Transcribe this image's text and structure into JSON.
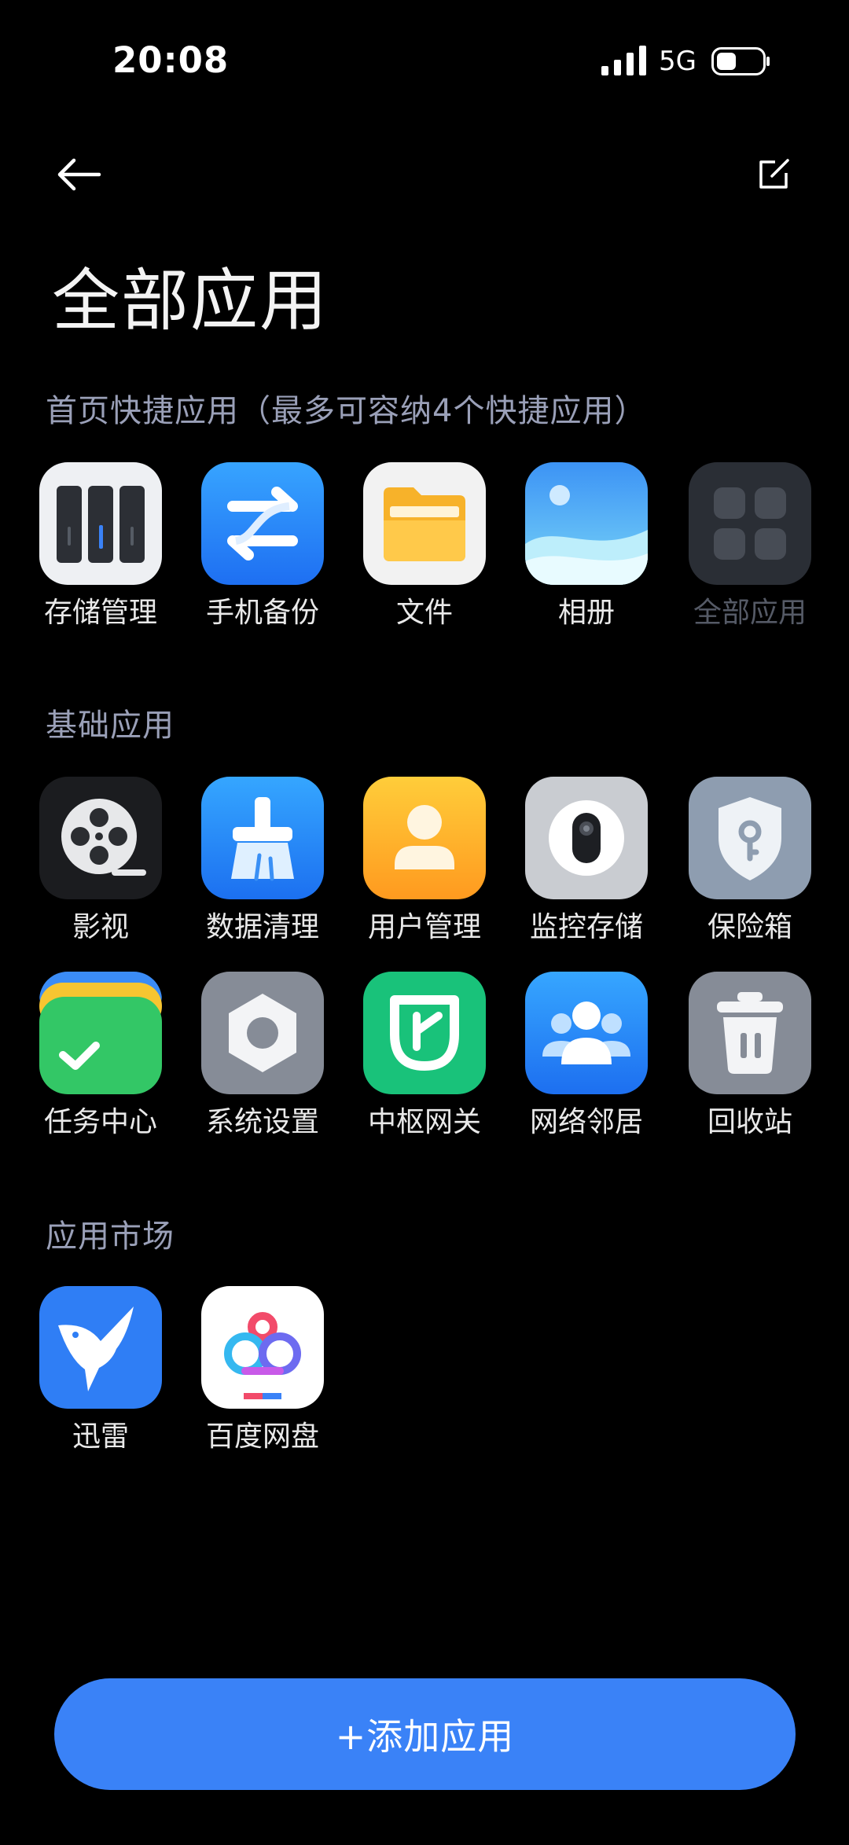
{
  "status_bar": {
    "time": "20:08",
    "network": "5G"
  },
  "header": {
    "title": "全部应用",
    "back_icon": "arrow-left-icon",
    "edit_icon": "edit-icon"
  },
  "sections": [
    {
      "title": "首页快捷应用（最多可容纳4个快捷应用）",
      "apps": [
        {
          "label": "存储管理",
          "icon": "storage-icon"
        },
        {
          "label": "手机备份",
          "icon": "backup-icon"
        },
        {
          "label": "文件",
          "icon": "folder-icon"
        },
        {
          "label": "相册",
          "icon": "album-icon"
        },
        {
          "label": "全部应用",
          "icon": "all-apps-icon",
          "dimmed": true
        }
      ]
    },
    {
      "title": "基础应用",
      "apps": [
        {
          "label": "影视",
          "icon": "film-reel-icon"
        },
        {
          "label": "数据清理",
          "icon": "broom-icon"
        },
        {
          "label": "用户管理",
          "icon": "user-icon"
        },
        {
          "label": "监控存储",
          "icon": "camera-icon"
        },
        {
          "label": "保险箱",
          "icon": "shield-lock-icon"
        },
        {
          "label": "任务中心",
          "icon": "task-check-icon"
        },
        {
          "label": "系统设置",
          "icon": "hex-nut-icon"
        },
        {
          "label": "中枢网关",
          "icon": "mi-home-icon"
        },
        {
          "label": "网络邻居",
          "icon": "people-icon"
        },
        {
          "label": "回收站",
          "icon": "trash-icon"
        }
      ]
    },
    {
      "title": "应用市场",
      "apps": [
        {
          "label": "迅雷",
          "icon": "hummingbird-icon"
        },
        {
          "label": "百度网盘",
          "icon": "cloud-icon"
        }
      ]
    }
  ],
  "add_button": {
    "label": "+添加应用"
  },
  "colors": {
    "accent": "#3a82f7",
    "section_title": "#9aa0b8",
    "background": "#000000"
  }
}
